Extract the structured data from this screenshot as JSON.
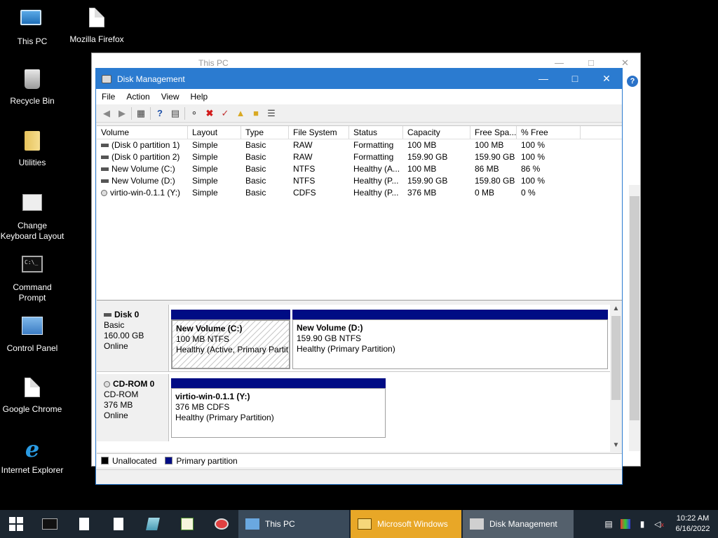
{
  "desktop": {
    "icons": [
      {
        "label": "This PC"
      },
      {
        "label": "Mozilla Firefox"
      },
      {
        "label": "Recycle Bin"
      },
      {
        "label": "Utilities"
      },
      {
        "label": "Change Keyboard Layout"
      },
      {
        "label": "Command Prompt"
      },
      {
        "label": "Control Panel"
      },
      {
        "label": "Google Chrome"
      },
      {
        "label": "Internet Explorer"
      }
    ]
  },
  "bg_window": {
    "title": "This PC"
  },
  "window": {
    "title": "Disk Management",
    "menu": [
      "File",
      "Action",
      "View",
      "Help"
    ],
    "columns": [
      "Volume",
      "Layout",
      "Type",
      "File System",
      "Status",
      "Capacity",
      "Free Spa...",
      "% Free"
    ],
    "volumes": [
      {
        "volume": "(Disk 0 partition 1)",
        "layout": "Simple",
        "type": "Basic",
        "fs": "RAW",
        "status": "Formatting",
        "capacity": "100 MB",
        "free": "100 MB",
        "pct": "100 %"
      },
      {
        "volume": "(Disk 0 partition 2)",
        "layout": "Simple",
        "type": "Basic",
        "fs": "RAW",
        "status": "Formatting",
        "capacity": "159.90 GB",
        "free": "159.90 GB",
        "pct": "100 %"
      },
      {
        "volume": "New Volume (C:)",
        "layout": "Simple",
        "type": "Basic",
        "fs": "NTFS",
        "status": "Healthy (A...",
        "capacity": "100 MB",
        "free": "86 MB",
        "pct": "86 %"
      },
      {
        "volume": "New Volume (D:)",
        "layout": "Simple",
        "type": "Basic",
        "fs": "NTFS",
        "status": "Healthy (P...",
        "capacity": "159.90 GB",
        "free": "159.80 GB",
        "pct": "100 %"
      },
      {
        "volume": "virtio-win-0.1.1 (Y:)",
        "layout": "Simple",
        "type": "Basic",
        "fs": "CDFS",
        "status": "Healthy (P...",
        "capacity": "376 MB",
        "free": "0 MB",
        "pct": "0 %"
      }
    ],
    "disks": [
      {
        "name": "Disk 0",
        "kind": "Basic",
        "size": "160.00 GB",
        "state": "Online",
        "partitions": [
          {
            "name": "New Volume  (C:)",
            "detail": "100 MB NTFS",
            "status": "Healthy (Active, Primary Partit"
          },
          {
            "name": "New Volume  (D:)",
            "detail": "159.90 GB NTFS",
            "status": "Healthy (Primary Partition)"
          }
        ]
      },
      {
        "name": "CD-ROM 0",
        "kind": "CD-ROM",
        "size": "376 MB",
        "state": "Online",
        "partitions": [
          {
            "name": "virtio-win-0.1.1  (Y:)",
            "detail": "376 MB CDFS",
            "status": "Healthy (Primary Partition)"
          }
        ]
      }
    ],
    "legend": [
      {
        "label": "Unallocated",
        "color": "#000000"
      },
      {
        "label": "Primary partition",
        "color": "#000c84"
      }
    ]
  },
  "taskbar": {
    "tasks": [
      {
        "label": "This PC",
        "color": "#3a4a5a"
      },
      {
        "label": "Microsoft Windows",
        "color": "#e8a727"
      },
      {
        "label": "Disk Management",
        "color": "#54606c"
      }
    ],
    "time": "10:22 AM",
    "date": "6/16/2022"
  }
}
